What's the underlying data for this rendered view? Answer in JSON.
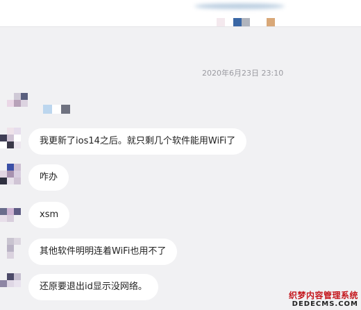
{
  "timestamp": "2020年6月23日 23:10",
  "messages": [
    {
      "text": "我更新了ios14之后。就只剩几个软件能用WiFi了"
    },
    {
      "text": "咋办"
    },
    {
      "text": "xsm"
    },
    {
      "text": "其他软件明明连着WiFi也用不了"
    },
    {
      "text": "还原要退出id显示没网络。"
    }
  ],
  "watermark": {
    "line1": "织梦内容管理系统",
    "line2": "DEDECMS.COM"
  }
}
